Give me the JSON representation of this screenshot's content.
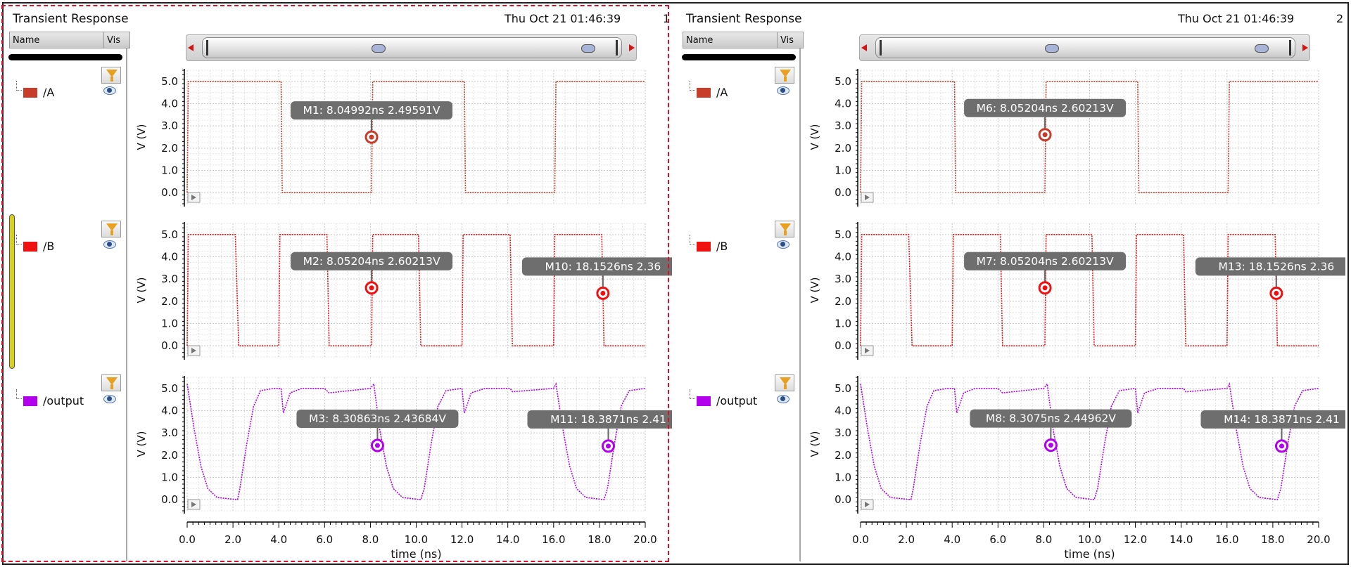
{
  "panels": [
    {
      "title": "Transient Response",
      "date": "Thu Oct 21 01:46:39",
      "number": "1",
      "selected": true,
      "list_header": {
        "name": "Name",
        "vis": "Vis"
      },
      "signals": [
        {
          "label": "/A",
          "color": "#c83c2a"
        },
        {
          "label": "/B",
          "color": "#f01010"
        },
        {
          "label": "/output",
          "color": "#b200ee"
        }
      ],
      "markers": [
        {
          "label": "M1: 8.04992ns 2.49591V",
          "x": 8.04992,
          "y": 2.49591,
          "plot": 0
        },
        {
          "label": "M2: 8.05204ns 2.60213V",
          "x": 8.05204,
          "y": 2.60213,
          "plot": 1
        },
        {
          "label": "M10: 18.1526ns 2.36",
          "x": 18.1526,
          "y": 2.36,
          "plot": 1
        },
        {
          "label": "M3: 8.30863ns 2.43684V",
          "x": 8.30863,
          "y": 2.43684,
          "plot": 2
        },
        {
          "label": "M11: 18.3871ns 2.41",
          "x": 18.3871,
          "y": 2.41,
          "plot": 2
        }
      ]
    },
    {
      "title": "Transient Response",
      "date": "Thu Oct 21 01:46:39",
      "number": "2",
      "selected": false,
      "list_header": {
        "name": "Name",
        "vis": "Vis"
      },
      "signals": [
        {
          "label": "/A",
          "color": "#c83c2a"
        },
        {
          "label": "/B",
          "color": "#f01010"
        },
        {
          "label": "/output",
          "color": "#b200ee"
        }
      ],
      "markers": [
        {
          "label": "M6: 8.05204ns 2.60213V",
          "x": 8.05204,
          "y": 2.60213,
          "plot": 0
        },
        {
          "label": "M7: 8.05204ns 2.60213V",
          "x": 8.05204,
          "y": 2.60213,
          "plot": 1
        },
        {
          "label": "M13: 18.1526ns 2.36",
          "x": 18.1526,
          "y": 2.36,
          "plot": 1
        },
        {
          "label": "M8: 8.3075ns 2.44962V",
          "x": 8.3075,
          "y": 2.44962,
          "plot": 2
        },
        {
          "label": "M14: 18.3871ns 2.41",
          "x": 18.3871,
          "y": 2.41,
          "plot": 2
        }
      ]
    }
  ],
  "chart_data": {
    "type": "line",
    "xlabel": "time (ns)",
    "ylabel": "V (V)",
    "xlim": [
      0,
      20
    ],
    "ylim": [
      -0.5,
      5.5
    ],
    "x_ticks": [
      "0.0",
      "2.0",
      "4.0",
      "6.0",
      "8.0",
      "10.0",
      "12.0",
      "14.0",
      "16.0",
      "18.0",
      "20.0"
    ],
    "y_ticks": [
      "0.0",
      "1.0",
      "2.0",
      "3.0",
      "4.0",
      "5.0"
    ],
    "grid": true,
    "series": [
      {
        "name": "/A",
        "color": "#c83c2a",
        "points": [
          [
            0,
            0
          ],
          [
            0.05,
            5
          ],
          [
            4.1,
            5
          ],
          [
            4.15,
            0
          ],
          [
            8.05,
            0
          ],
          [
            8.1,
            5
          ],
          [
            12.1,
            5
          ],
          [
            12.15,
            0
          ],
          [
            16.05,
            0
          ],
          [
            16.1,
            5
          ],
          [
            20,
            5
          ]
        ]
      },
      {
        "name": "/B",
        "color": "#f01010",
        "points": [
          [
            0,
            0
          ],
          [
            0.05,
            5
          ],
          [
            2.1,
            5
          ],
          [
            2.25,
            0
          ],
          [
            4.0,
            0
          ],
          [
            4.05,
            5
          ],
          [
            6.1,
            5
          ],
          [
            6.2,
            0
          ],
          [
            8.05,
            0
          ],
          [
            8.1,
            5
          ],
          [
            10.1,
            5
          ],
          [
            10.2,
            0
          ],
          [
            12.0,
            0
          ],
          [
            12.05,
            5
          ],
          [
            14.1,
            5
          ],
          [
            14.2,
            0
          ],
          [
            16.0,
            0
          ],
          [
            16.05,
            5
          ],
          [
            18.1,
            5
          ],
          [
            18.2,
            0
          ],
          [
            20,
            0
          ]
        ]
      },
      {
        "name": "/output",
        "color": "#b200ee",
        "points": [
          [
            0,
            5.2
          ],
          [
            0.3,
            3.2
          ],
          [
            0.6,
            1.5
          ],
          [
            0.9,
            0.5
          ],
          [
            1.3,
            0.1
          ],
          [
            2.2,
            0.0
          ],
          [
            2.3,
            0.5
          ],
          [
            2.6,
            2.5
          ],
          [
            2.9,
            4.2
          ],
          [
            3.2,
            4.9
          ],
          [
            3.8,
            5.0
          ],
          [
            4.1,
            5.0
          ],
          [
            4.2,
            3.9
          ],
          [
            4.5,
            4.8
          ],
          [
            5.0,
            5.0
          ],
          [
            6.0,
            5.0
          ],
          [
            6.2,
            4.8
          ],
          [
            8.0,
            5.0
          ],
          [
            8.15,
            5.2
          ],
          [
            8.4,
            3.2
          ],
          [
            8.7,
            1.5
          ],
          [
            9.0,
            0.5
          ],
          [
            9.4,
            0.1
          ],
          [
            10.2,
            0.0
          ],
          [
            10.35,
            0.5
          ],
          [
            10.65,
            2.5
          ],
          [
            10.95,
            4.2
          ],
          [
            11.3,
            4.9
          ],
          [
            12.0,
            5.0
          ],
          [
            12.1,
            3.9
          ],
          [
            12.4,
            4.8
          ],
          [
            13.0,
            5.0
          ],
          [
            14.1,
            5.0
          ],
          [
            14.2,
            4.85
          ],
          [
            16.0,
            5.0
          ],
          [
            16.1,
            5.2
          ],
          [
            16.4,
            3.2
          ],
          [
            16.7,
            1.5
          ],
          [
            17.0,
            0.5
          ],
          [
            17.4,
            0.1
          ],
          [
            18.2,
            0.0
          ],
          [
            18.35,
            0.5
          ],
          [
            18.65,
            2.5
          ],
          [
            18.95,
            4.2
          ],
          [
            19.3,
            4.9
          ],
          [
            20,
            5.0
          ]
        ]
      }
    ]
  }
}
